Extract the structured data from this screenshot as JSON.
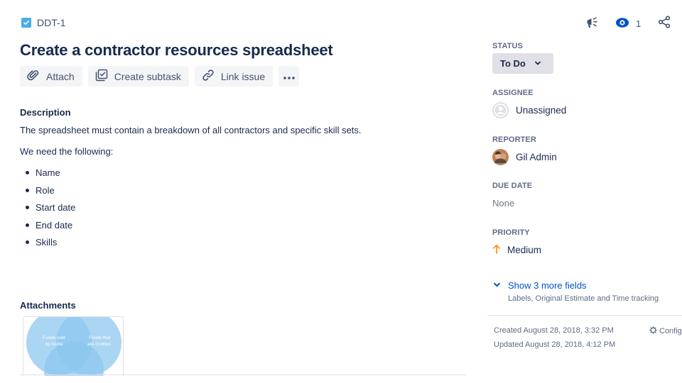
{
  "issue": {
    "key": "DDT-1",
    "type_icon": "checkbox-icon",
    "title": "Create a contractor resources spreadsheet"
  },
  "actions": {
    "attach": "Attach",
    "create_subtask": "Create subtask",
    "link_issue": "Link issue",
    "more": "more-icon"
  },
  "description": {
    "heading": "Description",
    "line1": "The spreadsheet must contain a breakdown of all contractors and specific skill sets.",
    "line2": "We need the following:",
    "items": [
      "Name",
      "Role",
      "Start date",
      "End date",
      "Skills"
    ]
  },
  "attachments": {
    "heading": "Attachments",
    "thumbnail": {
      "left_label_1": "Foods sold",
      "left_label_2": "by Acme",
      "right_label_1": "Foods that",
      "right_label_2": "are cookies"
    }
  },
  "header_icons": {
    "feedback": "megaphone-icon",
    "watch": "eye-icon",
    "watch_count": "1",
    "share": "share-icon"
  },
  "fields": {
    "status": {
      "label": "STATUS",
      "value": "To Do"
    },
    "assignee": {
      "label": "ASSIGNEE",
      "value": "Unassigned"
    },
    "reporter": {
      "label": "REPORTER",
      "value": "Gil Admin"
    },
    "due_date": {
      "label": "DUE DATE",
      "value": "None"
    },
    "priority": {
      "label": "PRIORITY",
      "value": "Medium"
    }
  },
  "show_more": {
    "label": "Show 3 more fields",
    "sub": "Labels, Original Estimate and Time tracking"
  },
  "meta": {
    "created": "Created August 28, 2018, 3:32 PM",
    "updated": "Updated August 28, 2018, 4:12 PM",
    "configure": "Configure"
  },
  "colors": {
    "link_blue": "#0052cc",
    "priority_medium": "#ff991f",
    "issue_type_task": "#4bade8",
    "text_primary": "#172b4d",
    "text_subtle": "#5e6c84"
  }
}
